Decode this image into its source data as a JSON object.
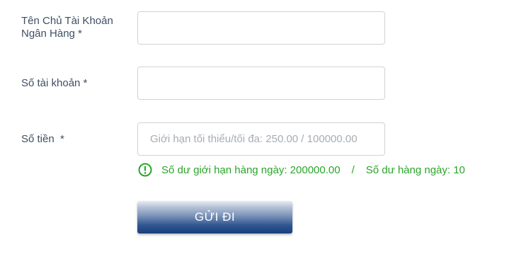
{
  "form": {
    "account_holder": {
      "label": "Tên Chủ Tài Khoản Ngân Hàng *",
      "value": ""
    },
    "account_number": {
      "label": "Số tài khoản *",
      "value": ""
    },
    "amount": {
      "label": "Số tiền  *",
      "value": "",
      "placeholder": "Giới hạn tối thiểu/tối đa: 250.00 / 100000.00"
    },
    "hint": {
      "icon": "exclamation-circle-icon",
      "color": "#2aa52a",
      "daily_limit": "Số dư giới hạn hàng ngày: 200000.00",
      "separator": "/",
      "daily_count": "Số dư hàng ngày: 10"
    },
    "submit_label": "GỬI ĐI"
  }
}
